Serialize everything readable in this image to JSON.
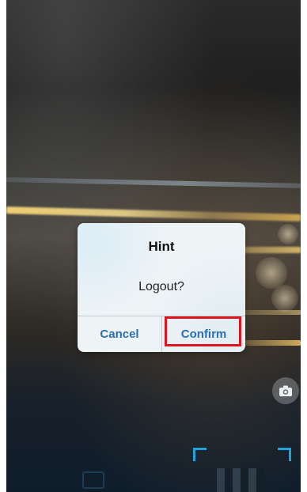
{
  "dialog": {
    "title": "Hint",
    "message": "Logout?",
    "cancel_label": "Cancel",
    "confirm_label": "Confirm"
  },
  "icons": {
    "camera_switch": "camera-icon"
  },
  "colors": {
    "button_text": "#2a6fb5",
    "highlight": "#e0141e",
    "scan_frame": "#1fa3d8"
  }
}
